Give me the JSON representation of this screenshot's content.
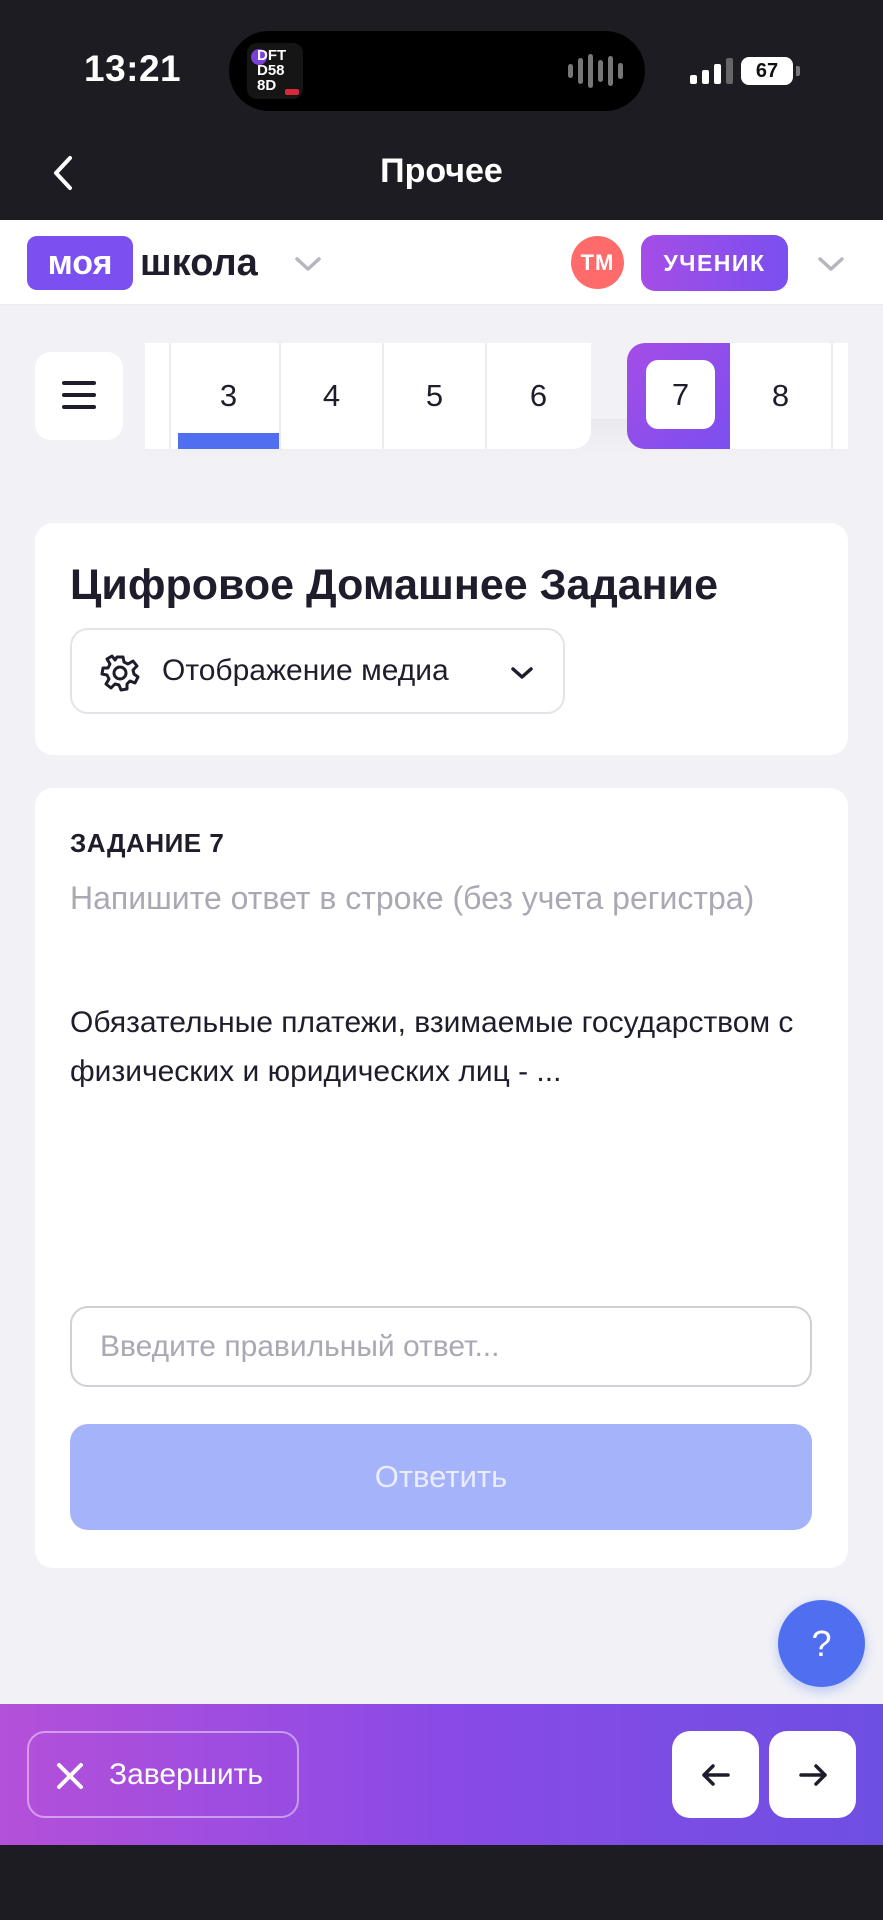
{
  "status_bar": {
    "time": "13:21",
    "island_app_text": "DFT D58 8D",
    "battery": "67"
  },
  "nav": {
    "title": "Прочее"
  },
  "header": {
    "logo_box": "моя",
    "logo_word": "школа",
    "avatar_initials": "ТМ",
    "role": "УЧЕНИК"
  },
  "pager": {
    "pages": [
      "3",
      "4",
      "5",
      "6"
    ],
    "active_page": "3",
    "current_page": "7",
    "next_page": "8"
  },
  "assignment": {
    "title": "Цифровое Домашнее Задание",
    "media_label": "Отображение медиа"
  },
  "task": {
    "number_label": "ЗАДАНИЕ 7",
    "hint": "Напишите ответ в строке (без учета регистра)",
    "question": "Обязательные платежи, взимаемые государством с физических и юридических лиц - ...",
    "input_value": "",
    "input_placeholder": "Введите правильный ответ...",
    "submit_label": "Ответить"
  },
  "help": {
    "label": "?"
  },
  "footer": {
    "finish_label": "Завершить"
  },
  "colors": {
    "accent_blue": "#4f6ff0",
    "accent_purple": "#7b4ff0",
    "avatar_red": "#ff6b6b",
    "submit_disabled": "#a4b3fa"
  },
  "icons": [
    "back-icon",
    "chevron-down-icon",
    "menu-icon",
    "gear-icon",
    "close-icon",
    "arrow-left-icon",
    "arrow-right-icon",
    "signal-icon",
    "battery-icon"
  ]
}
